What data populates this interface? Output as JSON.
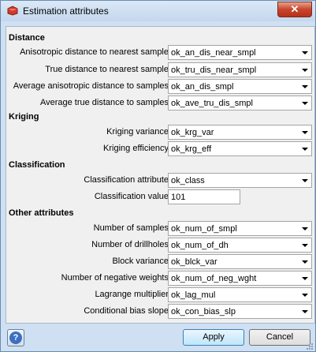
{
  "window": {
    "title": "Estimation attributes",
    "close_symbol": "✕",
    "help_symbol": "?"
  },
  "sections": {
    "distance": "Distance",
    "kriging": "Kriging",
    "classification": "Classification",
    "other": "Other attributes"
  },
  "rows": [
    {
      "label": "Anisotropic distance to nearest sample",
      "value": "ok_an_dis_near_smpl"
    },
    {
      "label": "True distance to nearest sample",
      "value": "ok_tru_dis_near_smpl"
    },
    {
      "label": "Average anisotropic distance to samples",
      "value": "ok_an_dis_smpl"
    },
    {
      "label": "Average true distance to samples",
      "value": "ok_ave_tru_dis_smpl"
    },
    {
      "label": "Kriging variance",
      "value": "ok_krg_var"
    },
    {
      "label": "Kriging efficiency",
      "value": "ok_krg_eff"
    },
    {
      "label": "Classification attribute",
      "value": "ok_class"
    },
    {
      "label": "Classification value",
      "value": "101"
    },
    {
      "label": "Number of samples",
      "value": "ok_num_of_smpl"
    },
    {
      "label": "Number of drillholes",
      "value": "ok_num_of_dh"
    },
    {
      "label": "Block variance",
      "value": "ok_blck_var"
    },
    {
      "label": "Number of negative weights",
      "value": "ok_num_of_neg_wght"
    },
    {
      "label": "Lagrange multiplier",
      "value": "ok_lag_mul"
    },
    {
      "label": "Conditional bias slope",
      "value": "ok_con_bias_slp"
    }
  ],
  "buttons": {
    "apply": "Apply",
    "cancel": "Cancel"
  }
}
